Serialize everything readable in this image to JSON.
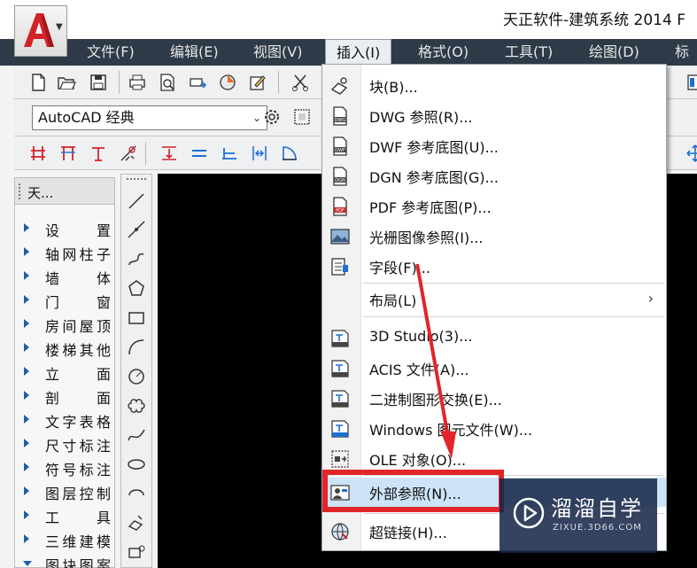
{
  "title_bar": {
    "title": "天正软件-建筑系统 2014  F"
  },
  "menu_bar": {
    "items": [
      {
        "label": "文件(F)"
      },
      {
        "label": "编辑(E)"
      },
      {
        "label": "视图(V)"
      },
      {
        "label": "插入(I)",
        "active": true
      },
      {
        "label": "格式(O)"
      },
      {
        "label": "工具(T)"
      },
      {
        "label": "绘图(D)"
      },
      {
        "label": "标"
      }
    ]
  },
  "workspace": {
    "selected": "AutoCAD 经典"
  },
  "left_panel": {
    "title": "天...",
    "items": [
      {
        "label": "设置"
      },
      {
        "label": "轴网柱子"
      },
      {
        "label": "墙体"
      },
      {
        "label": "门窗"
      },
      {
        "label": "房间屋顶"
      },
      {
        "label": "楼梯其他"
      },
      {
        "label": "立面"
      },
      {
        "label": "剖面"
      },
      {
        "label": "文字表格"
      },
      {
        "label": "尺寸标注"
      },
      {
        "label": "符号标注"
      },
      {
        "label": "图层控制"
      },
      {
        "label": "工具"
      },
      {
        "label": "三维建模"
      },
      {
        "label": "图块图案"
      }
    ]
  },
  "insert_menu": {
    "items": [
      {
        "label": "块(B)...",
        "icon": "block-icon"
      },
      {
        "label": "DWG 参照(R)...",
        "icon": "dwg-icon"
      },
      {
        "label": "DWF 参考底图(U)...",
        "icon": "dwf-icon"
      },
      {
        "label": "DGN 参考底图(G)...",
        "icon": "dgn-icon"
      },
      {
        "label": "PDF 参考底图(P)...",
        "icon": "pdf-icon"
      },
      {
        "label": "光栅图像参照(I)...",
        "icon": "raster-image-icon"
      },
      {
        "label": "字段(F)...",
        "icon": "field-icon"
      },
      {
        "label": "布局(L)",
        "icon": "",
        "submenu": true
      },
      {
        "label": "3D Studio(3)...",
        "icon": "3ds-icon"
      },
      {
        "label": "ACIS 文件(A)...",
        "icon": "acis-icon"
      },
      {
        "label": "二进制图形交换(E)...",
        "icon": "xbin-icon"
      },
      {
        "label": "Windows 图元文件(W)...",
        "icon": "wmf-icon"
      },
      {
        "label": "OLE 对象(O)...",
        "icon": "ole-icon"
      },
      {
        "label": "外部参照(N)...",
        "icon": "xref-icon",
        "highlighted": true
      },
      {
        "label": "超链接(H)...",
        "icon": "hyperlink-icon"
      }
    ]
  },
  "watermark": {
    "name": "溜溜自学",
    "url": "ZIXUE.3D66.COM"
  },
  "colors": {
    "menubar_bg": "#2f3a48",
    "highlight_box": "#e0262b",
    "canvas_bg": "#000000",
    "watermark_bg": "#142346"
  }
}
